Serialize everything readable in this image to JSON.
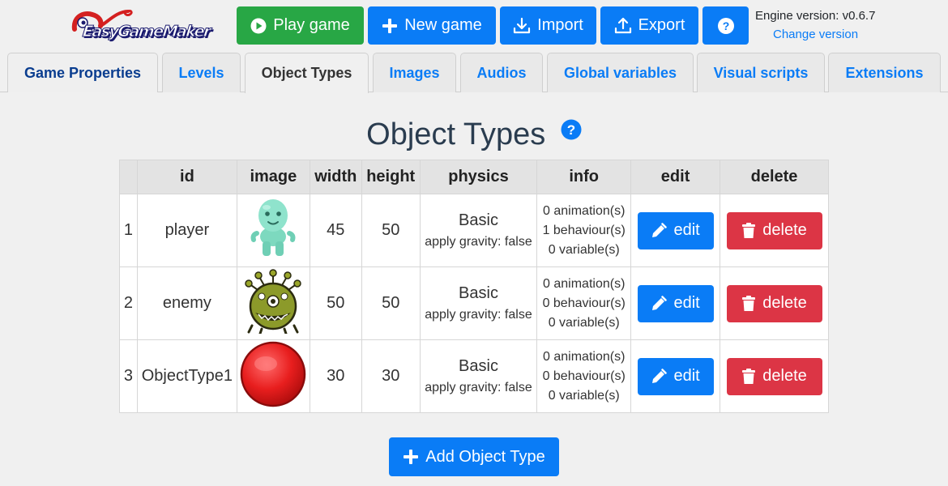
{
  "app": {
    "logo_text": "EasyGameMaker",
    "engine_version": "Engine version: v0.6.7",
    "change_version": "Change version"
  },
  "toolbar": {
    "play_label": "Play game",
    "new_label": "New game",
    "import_label": "Import",
    "export_label": "Export"
  },
  "tabs": [
    {
      "label": "Game Properties"
    },
    {
      "label": "Levels"
    },
    {
      "label": "Object Types"
    },
    {
      "label": "Images"
    },
    {
      "label": "Audios"
    },
    {
      "label": "Global variables"
    },
    {
      "label": "Visual scripts"
    },
    {
      "label": "Extensions"
    }
  ],
  "page": {
    "title": "Object Types"
  },
  "table": {
    "headers": [
      "",
      "id",
      "image",
      "width",
      "height",
      "physics",
      "info",
      "edit",
      "delete"
    ],
    "rows": [
      {
        "num": "1",
        "id": "player",
        "image": "green-alien-sprite",
        "width": "45",
        "height": "50",
        "physics": "Basic",
        "gravity": "apply gravity: false",
        "animations": "0 animation(s)",
        "behaviours": "1 behaviour(s)",
        "variables": "0 variable(s)",
        "edit": "edit",
        "delete": "delete"
      },
      {
        "num": "2",
        "id": "enemy",
        "image": "olive-monster-sprite",
        "width": "50",
        "height": "50",
        "physics": "Basic",
        "gravity": "apply gravity: false",
        "animations": "0 animation(s)",
        "behaviours": "0 behaviour(s)",
        "variables": "0 variable(s)",
        "edit": "edit",
        "delete": "delete"
      },
      {
        "num": "3",
        "id": "ObjectType1",
        "image": "red-ball-sprite",
        "width": "30",
        "height": "30",
        "physics": "Basic",
        "gravity": "apply gravity: false",
        "animations": "0 animation(s)",
        "behaviours": "0 behaviour(s)",
        "variables": "0 variable(s)",
        "edit": "edit",
        "delete": "delete"
      }
    ]
  },
  "add_button": {
    "label": "Add Object Type"
  },
  "colors": {
    "primary": "#0a7cf6",
    "success": "#28a745",
    "danger": "#dc3545"
  }
}
